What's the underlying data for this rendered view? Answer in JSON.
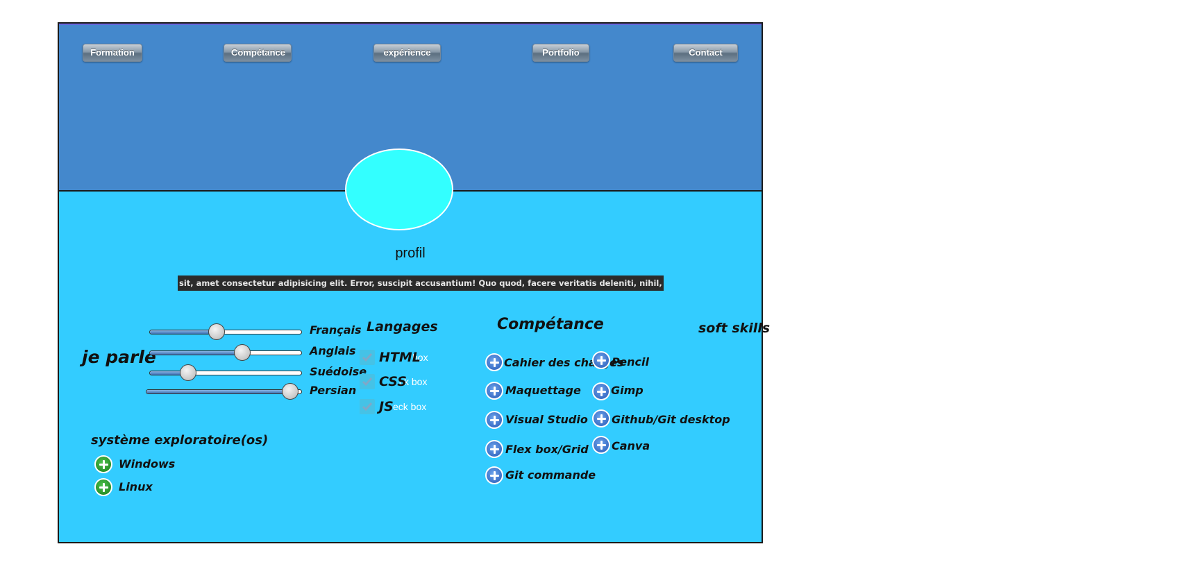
{
  "nav": {
    "formation": "Formation",
    "competance": "Compétance",
    "experience": "expérience",
    "portfolio": "Portfolio",
    "contact": "Contact"
  },
  "profile": {
    "title": "profil",
    "text": "sit, amet consectetur adipisicing elit. Error, suscipit accusantium! Quo quod, facere veritatis deleniti, nihil,"
  },
  "languages_spoken": {
    "heading": "je parle",
    "items": [
      {
        "label": "Français",
        "level": 0.44
      },
      {
        "label": "Anglais",
        "level": 0.61
      },
      {
        "label": "Suédoise",
        "level": 0.25
      },
      {
        "label": "Persian",
        "level": 0.93
      }
    ]
  },
  "os": {
    "heading": "système exploratoire(os)",
    "items": [
      "Windows",
      "Linux"
    ]
  },
  "langages": {
    "heading": "Langages",
    "items": [
      {
        "label": "HTML",
        "checkbox_text": "box"
      },
      {
        "label": "CSS",
        "checkbox_text": "ck box"
      },
      {
        "label": "JS",
        "checkbox_text": "eck box"
      }
    ]
  },
  "competance": {
    "heading": "Compétance",
    "col1": [
      "Cahier des charges",
      "Maquettage",
      "Visual Studio",
      "Flex box/Grid",
      "Git commande"
    ],
    "col2": [
      "Pencil",
      "Gimp",
      "Github/Git desktop",
      "Canva"
    ]
  },
  "soft_skills": {
    "heading": "soft skills"
  },
  "colors": {
    "header": "#4488cc",
    "body": "#33ccff",
    "avatar": "#33ffff"
  }
}
